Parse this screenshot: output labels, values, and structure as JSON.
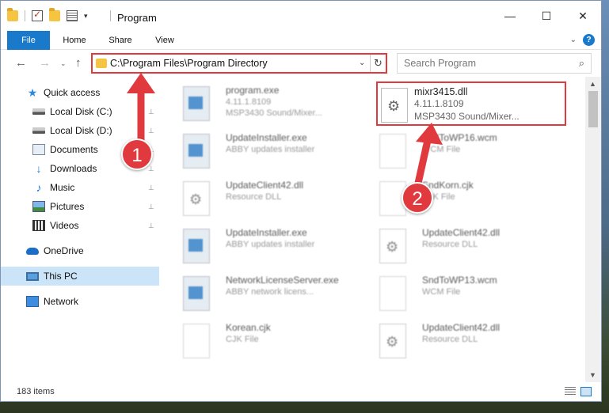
{
  "window": {
    "title": "Program",
    "controls": {
      "minimize": "—",
      "maximize": "☐",
      "close": "✕"
    }
  },
  "ribbon": {
    "tabs": [
      {
        "label": "File",
        "active": true
      },
      {
        "label": "Home"
      },
      {
        "label": "Share"
      },
      {
        "label": "View"
      }
    ],
    "help": "?",
    "collapse": "⌄"
  },
  "address": {
    "path": "C:\\Program Files\\Program Directory",
    "dropdown": "⌄",
    "refresh": "↻"
  },
  "search": {
    "placeholder": "Search Program",
    "icon": "⌕"
  },
  "nav": {
    "back": "←",
    "forward": "→",
    "recent": "⌄",
    "up": "↑",
    "items": [
      {
        "label": "Quick access",
        "icon": "star-icon"
      },
      {
        "label": "Local Disk (C:)",
        "icon": "disk-icon",
        "pinned": true
      },
      {
        "label": "Local Disk (D:)",
        "icon": "disk-icon",
        "pinned": true
      },
      {
        "label": "Documents",
        "icon": "documents-icon",
        "pinned": true
      },
      {
        "label": "Downloads",
        "icon": "downloads-icon",
        "pinned": true
      },
      {
        "label": "Music",
        "icon": "music-icon",
        "pinned": true
      },
      {
        "label": "Pictures",
        "icon": "pictures-icon",
        "pinned": true
      },
      {
        "label": "Videos",
        "icon": "videos-icon",
        "pinned": true
      },
      {
        "label": "OneDrive",
        "icon": "cloud-icon"
      },
      {
        "label": "This PC",
        "icon": "computer-icon",
        "selected": true
      },
      {
        "label": "Network",
        "icon": "network-icon"
      }
    ],
    "pin": "📌"
  },
  "files": [
    {
      "name": "program.exe",
      "line2": "4.11.1.8109",
      "line3": "MSP3430 Sound/Mixer...",
      "type": "exe"
    },
    {
      "name": "mixr3415.dll",
      "line2": "4.11.1.8109",
      "line3": "MSP3430 Sound/Mixer...",
      "type": "dll",
      "highlight": true
    },
    {
      "name": "UpdateInstaller.exe",
      "line2": "ABBY updates installer",
      "line3": "",
      "type": "exe"
    },
    {
      "name": "SndToWP16.wcm",
      "line2": "WCM File",
      "line3": "",
      "type": "blank"
    },
    {
      "name": "UpdateClient42.dll",
      "line2": "Resource DLL",
      "line3": "",
      "type": "dll"
    },
    {
      "name": "SndKorn.cjk",
      "line2": "CJK File",
      "line3": "",
      "type": "blank"
    },
    {
      "name": "UpdateInstaller.exe",
      "line2": "ABBY updates installer",
      "line3": "",
      "type": "exe"
    },
    {
      "name": "UpdateClient42.dll",
      "line2": "Resource DLL",
      "line3": "",
      "type": "dll"
    },
    {
      "name": "NetworkLicenseServer.exe",
      "line2": "ABBY network licens...",
      "line3": "",
      "type": "exe"
    },
    {
      "name": "SndToWP13.wcm",
      "line2": "WCM File",
      "line3": "",
      "type": "blank"
    },
    {
      "name": "Korean.cjk",
      "line2": "CJK File",
      "line3": "",
      "type": "blank"
    },
    {
      "name": "UpdateClient42.dll",
      "line2": "Resource DLL",
      "line3": "",
      "type": "dll"
    }
  ],
  "status": {
    "items": "183 items"
  },
  "annotations": [
    {
      "label": "1"
    },
    {
      "label": "2"
    }
  ],
  "colors": {
    "accent": "#1979ca",
    "annotation": "#e0393e",
    "selection": "#cce4f7"
  }
}
